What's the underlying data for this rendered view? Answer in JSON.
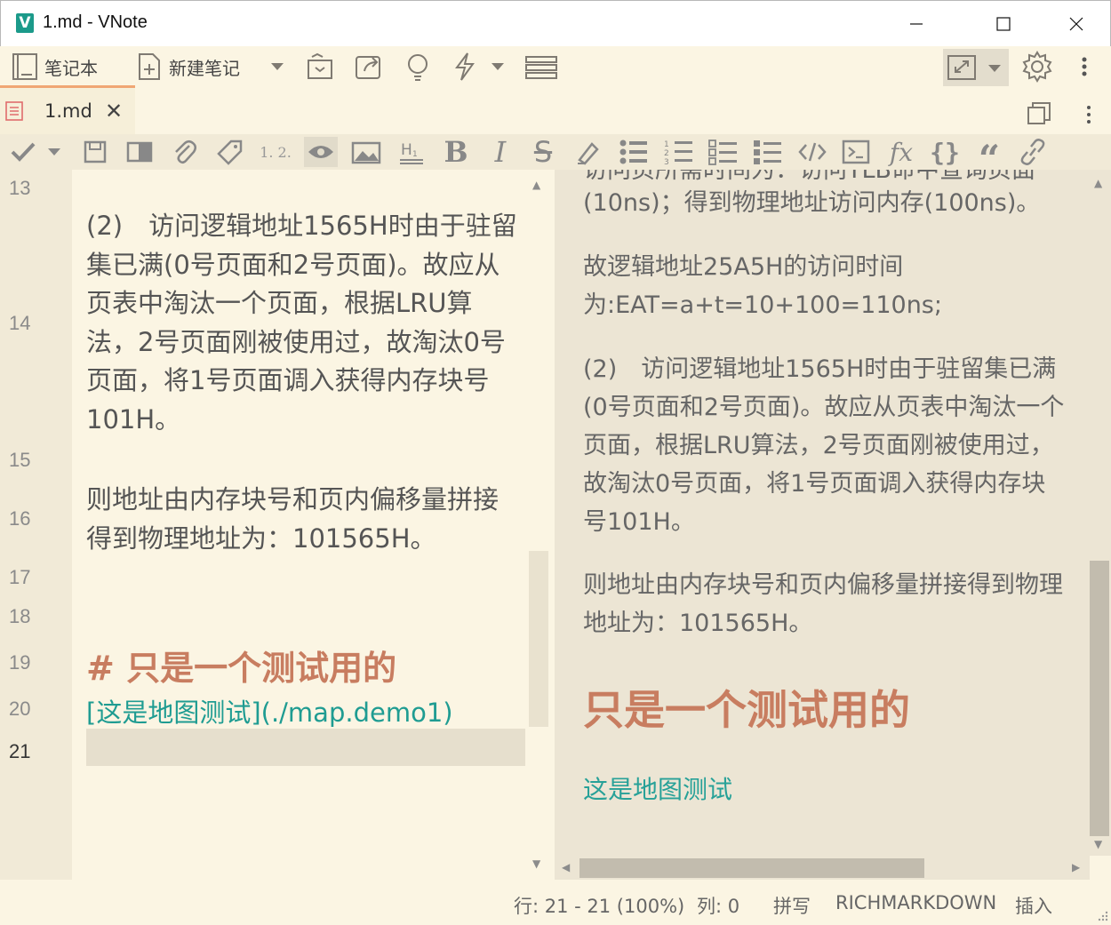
{
  "window": {
    "title": "1.md - VNote",
    "logo_letter": "V"
  },
  "toolbar": {
    "notebook_label": "笔记本",
    "new_note_label": "新建笔记"
  },
  "tabs": [
    {
      "label": "1.md"
    }
  ],
  "editor": {
    "line_numbers": [
      "13",
      "14",
      "15",
      "16",
      "17",
      "18",
      "19",
      "20",
      "21"
    ],
    "current_line": "21",
    "paragraphs": [
      "(2)　访问逻辑地址1565H时由于驻留集已满(0号页面和2号页面)。故应从页表中淘汰一个页面，根据LRU算法，2号页面刚被使用过，故淘汰0号页面，将1号页面调入获得内存块号101H。",
      "则地址由内存块号和页内偏移量拼接得到物理地址为：101565H。"
    ],
    "heading_markdown": "# 只是一个测试用的",
    "link_markdown": "[这是地图测试](./map.demo1)"
  },
  "preview": {
    "top_partial_line": "访问页所需时间为：访问TLB命中查询页面",
    "p1": "(10ns)；得到物理地址访问内存(100ns)。",
    "p2": "故逻辑地址25A5H的访问时间为:EAT=a+t=10+100=110ns;",
    "p3": "(2)　访问逻辑地址1565H时由于驻留集已满(0号页面和2号页面)。故应从页表中淘汰一个页面，根据LRU算法，2号页面刚被使用过，故淘汰0号页面，将1号页面调入获得内存块号101H。",
    "p4": "则地址由内存块号和页内偏移量拼接得到物理地址为：101565H。",
    "heading": "只是一个测试用的",
    "link_text": "这是地图测试"
  },
  "statusbar": {
    "position": "行: 21 - 21 (100%)",
    "column": "列: 0",
    "spell": "拼写",
    "mode": "RICHMARKDOWN",
    "insert": "插入"
  },
  "icons": {
    "editor_toolbar": [
      "check-icon",
      "dropdown-icon",
      "save-icon",
      "outline-icon",
      "attachment-icon",
      "tag-icon",
      "heading-sequence-icon",
      "preview-eye-icon",
      "image-icon",
      "heading-icon",
      "bold-icon",
      "italic-icon",
      "strikethrough-icon",
      "highlight-icon",
      "unordered-list-icon",
      "ordered-list-icon",
      "todo-list-icon",
      "checked-list-icon",
      "inline-code-icon",
      "code-block-icon",
      "math-icon",
      "braces-icon",
      "quote-icon",
      "link-icon"
    ]
  },
  "colors": {
    "background": "#fbf5e3",
    "heading": "#c87d60",
    "link": "#1f9c92",
    "accent_tab": "#f0a674",
    "logo": "#1b9a8a"
  }
}
